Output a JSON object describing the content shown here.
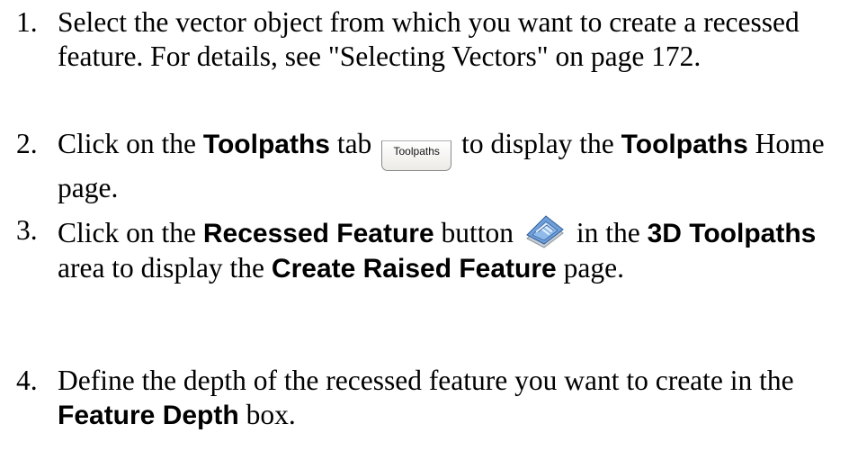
{
  "steps": [
    {
      "num": "1.",
      "text": "Select the vector object from which you want to create a recessed feature. For details, see \"Selecting Vectors\" on page 172."
    },
    {
      "num": "2.",
      "t1": "Click on the ",
      "b1": "Toolpaths",
      "t2": " tab ",
      "tab_label": "Toolpaths",
      "t3": " to display the ",
      "b2": "Toolpaths",
      "t4": " Home page."
    },
    {
      "num": "3.",
      "t1": "Click on the ",
      "b1": "Recessed Feature",
      "t2": " button ",
      "icon": "recessed-feature-icon",
      "t3": " in the ",
      "b2": "3D Toolpaths",
      "t4": " area to display the ",
      "b3": "Create Raised Feature",
      "t5": " page."
    },
    {
      "num": "4.",
      "t1": "Define the depth of the recessed feature you want to create in the ",
      "b1": "Feature Depth",
      "t2": " box."
    }
  ]
}
